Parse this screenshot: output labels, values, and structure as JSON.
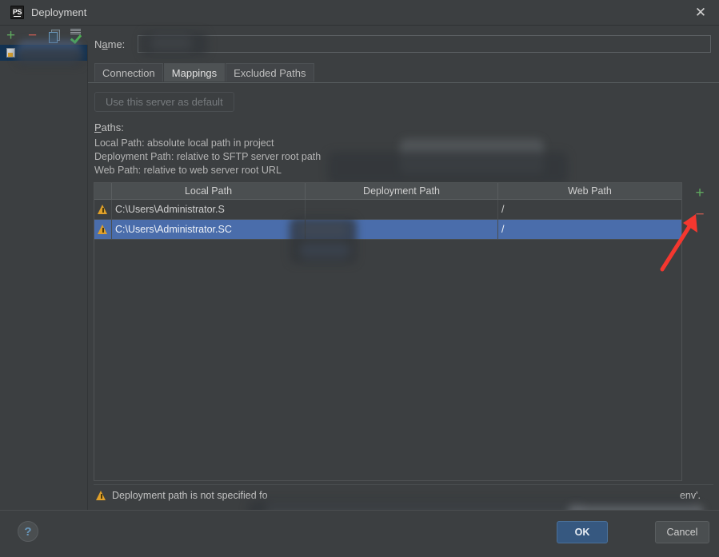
{
  "window": {
    "title": "Deployment",
    "app_icon": "phpstorm-ps-icon",
    "close_icon": "close-icon"
  },
  "toolbar": {
    "add_icon": "plus-icon",
    "remove_icon": "minus-icon",
    "copy_icon": "copy-icon",
    "set_default_icon": "checkmark-icon"
  },
  "sidebar": {
    "items": [
      {
        "label": "",
        "redacted": true,
        "selected": true,
        "icon": "server-icon"
      }
    ]
  },
  "form": {
    "name_label_pre": "N",
    "name_label_mnemonic": "a",
    "name_label_post": "me:",
    "name_value": "",
    "name_placeholder": ""
  },
  "tabs": [
    {
      "label": "Connection",
      "active": false
    },
    {
      "label": "Mappings",
      "active": true
    },
    {
      "label": "Excluded Paths",
      "active": false
    }
  ],
  "buttons": {
    "use_default": "Use this server as default",
    "use_default_enabled": false
  },
  "paths_section": {
    "label_pre": "P",
    "label_mnemonic": "",
    "label_text": "Paths:",
    "hints": [
      "Local Path: absolute local path in project",
      "Deployment Path: relative to SFTP server root path",
      "Web Path: relative to web server root URL"
    ]
  },
  "table": {
    "columns": [
      "",
      "Local Path",
      "Deployment Path",
      "Web Path"
    ],
    "rows": [
      {
        "status_icon": "warning-icon",
        "local_path": "C:\\Users\\Administrator.S",
        "local_path_redacted": true,
        "deployment_path": "",
        "web_path": "/",
        "selected": false
      },
      {
        "status_icon": "warning-icon",
        "local_path": "C:\\Users\\Administrator.SC",
        "local_path_redacted": true,
        "deployment_path": "",
        "web_path": "/",
        "selected": true
      }
    ],
    "add_icon": "plus-icon",
    "remove_icon": "minus-icon"
  },
  "status": {
    "icon": "warning-icon",
    "message": "Deployment path is not specified fo",
    "message_tail": "env'."
  },
  "footer": {
    "help_label": "?",
    "ok_label": "OK",
    "cancel_label": "Cancel"
  },
  "annotation": {
    "arrow_color": "#f4372f",
    "points_at": "table-remove-button"
  },
  "colors": {
    "background": "#3c3f41",
    "selection_blue": "#4a6dab",
    "sidebar_selection": "#123252",
    "ok_button": "#365880",
    "warning": "#e0a02a",
    "add_green": "#5fa85f",
    "remove_red": "#c45b50"
  }
}
